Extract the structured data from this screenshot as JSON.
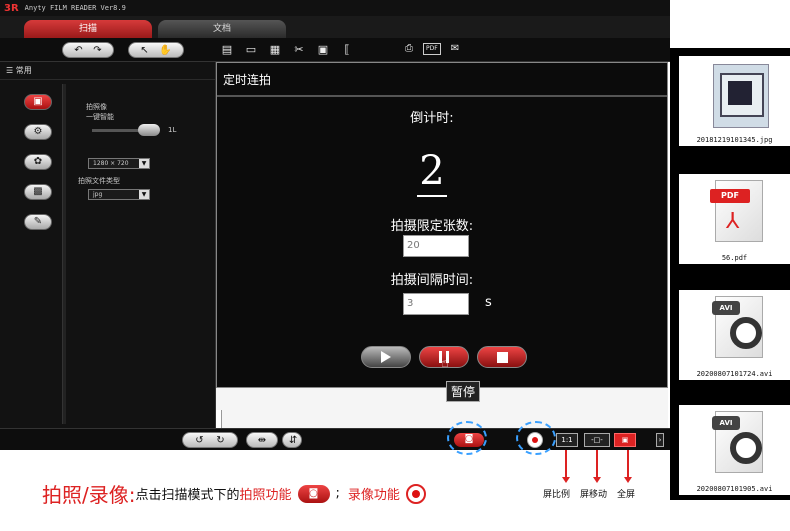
{
  "window": {
    "logo": "3R",
    "title": "Anyty FILM READER Ver8.9"
  },
  "tabs": [
    {
      "label": "扫描"
    },
    {
      "label": "文档"
    }
  ],
  "toolbar": {
    "undo": "↶",
    "redo": "↷",
    "pointer": "↖",
    "hand": "✋",
    "icons": [
      "▤",
      "▭",
      "▦",
      "✂",
      "▣",
      "⟦"
    ],
    "print": "⎙",
    "pdf": "PDF",
    "mail": "✉"
  },
  "left_panel": {
    "header": "常用",
    "camera_label": "拍照像",
    "mode_label": "一键智能",
    "resolution": "1280 × 720",
    "filetype_label": "拍照文件类型",
    "filetype": "jpg",
    "slider_value": "1L"
  },
  "dialog": {
    "title": "定时连拍",
    "countdown_label": "倒计时:",
    "countdown_value": "2",
    "limit_label": "拍摄限定张数:",
    "limit_value": "20",
    "interval_label": "拍摄间隔时间:",
    "interval_value": "3",
    "interval_unit": "s"
  },
  "tooltip": "暂停",
  "bottom": {
    "rotate_left": "↺",
    "rotate_right": "↻",
    "ratio": "1:1"
  },
  "thumbnails": [
    {
      "caption": "20181219101345.jpg"
    },
    {
      "badge": "PDF",
      "caption": "56.pdf"
    },
    {
      "badge": "AVI",
      "caption": "20200807101724.avi"
    },
    {
      "badge": "AVI",
      "caption": "20200807101905.avi"
    }
  ],
  "annotation": {
    "headline": "拍照/录像:",
    "text1": "点击扫描模式下的",
    "highlight1": "拍照功能",
    "sep": ";",
    "highlight2": "录像功能",
    "label_ratio": "屏比例",
    "label_move": "屏移动",
    "label_full": "全屏"
  },
  "colors": {
    "accent": "#d22222",
    "highlight_ring": "#3aa0ff"
  }
}
